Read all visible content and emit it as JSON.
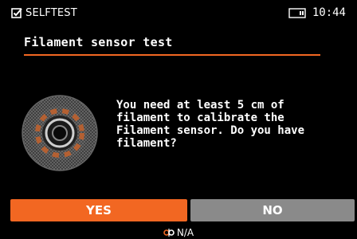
{
  "header": {
    "icon": "checkbox-icon",
    "title": "SELFTEST",
    "storage_icon": "storage-icon",
    "time": "10:44"
  },
  "page": {
    "title": "Filament sensor test",
    "message": "You need at least 5 cm of\nfilament to calibrate the\nFilament sensor. Do you have\nfilament?",
    "illustration": "filament-sensor-icon"
  },
  "buttons": {
    "yes": "YES",
    "no": "NO"
  },
  "footer": {
    "icon": "filament-sensor-status-icon",
    "value": "N/A"
  },
  "colors": {
    "accent": "#f26722",
    "secondary_button": "#8a8a8a",
    "background": "#000000",
    "text": "#ffffff"
  }
}
